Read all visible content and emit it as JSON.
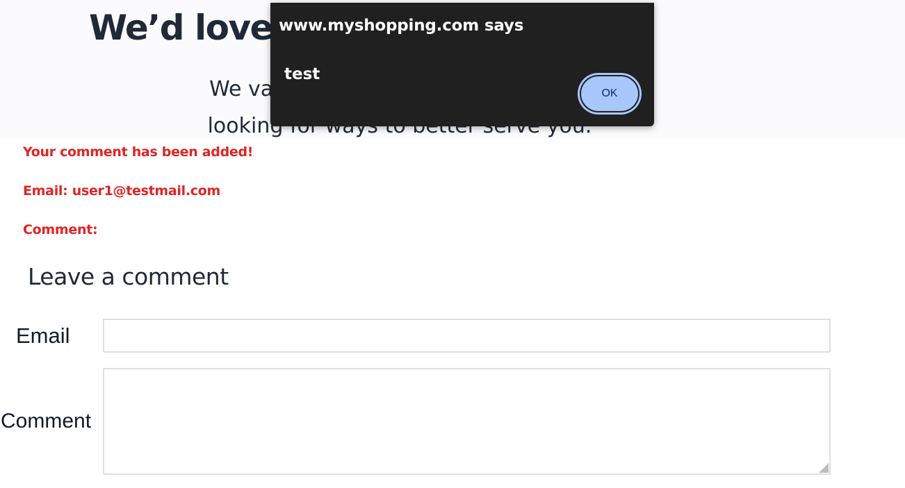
{
  "hero": {
    "title": "We’d love to hear from you!",
    "subtitle_line1": "We value your feedback and it helps",
    "subtitle_line2": "looking for ways to better serve you."
  },
  "alert": {
    "origin": "www.myshopping.com says",
    "message": "test",
    "ok_label": "OK"
  },
  "status": {
    "added": "Your comment has been added!",
    "email": "Email: user1@testmail.com",
    "comment": "Comment:"
  },
  "form": {
    "title": "Leave a comment",
    "email_label": "Email",
    "email_value": "",
    "comment_label": "Comment",
    "comment_value": ""
  },
  "colors": {
    "accent_red": "#e02424",
    "alert_bg": "#202020",
    "ok_button": "#a8c7fa"
  }
}
